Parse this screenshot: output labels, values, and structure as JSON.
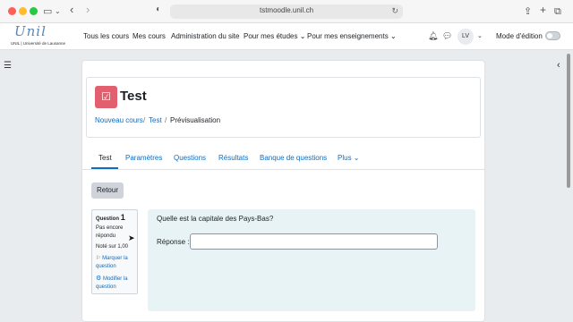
{
  "browser": {
    "url": "tstmoodle.unil.ch"
  },
  "navbar": {
    "logo_script": "Unil",
    "logo_sub": "UNIL | Université de Lausanne",
    "links": [
      "Tous les cours",
      "Mes cours",
      "Administration du site",
      "Pour mes études ⌄",
      "Pour mes enseignements ⌄"
    ],
    "avatar_initials": "LV",
    "edit_mode_label": "Mode d'édition"
  },
  "header": {
    "title": "Test",
    "breadcrumb": [
      "Nouveau cours",
      "Test",
      "Prévisualisation"
    ]
  },
  "tabs": [
    "Test",
    "Paramètres",
    "Questions",
    "Résultats",
    "Banque de questions",
    "Plus ⌄"
  ],
  "back_button": "Retour",
  "question_info": {
    "prefix": "Question",
    "number": "1",
    "state": "Pas encore répondu",
    "grade": "Noté sur 1,00",
    "flag_link": "Marquer la question",
    "edit_link": "Modifier la question"
  },
  "question": {
    "text": "Quelle est la capitale des Pays-Bas?",
    "answer_label": "Réponse :",
    "answer_value": ""
  }
}
